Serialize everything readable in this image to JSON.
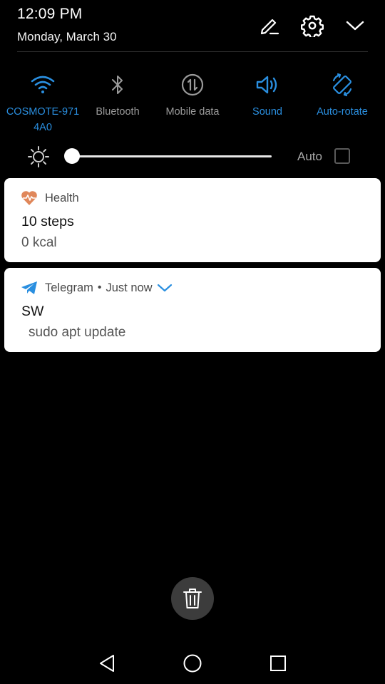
{
  "status": {
    "time": "12:09 PM",
    "date": "Monday, March 30"
  },
  "header_icons": {
    "edit": "edit-pencil-icon",
    "settings": "gear-icon",
    "collapse": "chevron-down-icon"
  },
  "quick_tiles": [
    {
      "label_line1": "COSMOTE-971",
      "label_line2": "4A0",
      "icon": "wifi-icon",
      "active": true
    },
    {
      "label_line1": "Bluetooth",
      "label_line2": "",
      "icon": "bluetooth-icon",
      "active": false
    },
    {
      "label_line1": "Mobile data",
      "label_line2": "",
      "icon": "mobile-data-icon",
      "active": false
    },
    {
      "label_line1": "Sound",
      "label_line2": "",
      "icon": "speaker-icon",
      "active": true
    },
    {
      "label_line1": "Auto-rotate",
      "label_line2": "",
      "icon": "auto-rotate-icon",
      "active": true
    }
  ],
  "brightness": {
    "auto_label": "Auto",
    "auto_checked": false,
    "level": 0.0
  },
  "notifications": [
    {
      "app": "Health",
      "icon": "heart-pulse-icon",
      "title": "10 steps",
      "body": "0 kcal"
    },
    {
      "app": "Telegram",
      "separator": "•",
      "time": "Just now",
      "icon": "telegram-plane-icon",
      "title": "SW",
      "body": "sudo apt update"
    }
  ],
  "colors": {
    "accent": "#2a8fe0",
    "health": "#e0875a",
    "telegram": "#2a8fe0",
    "inactive": "#9a9a9a"
  },
  "nav": {
    "back": "back-triangle-icon",
    "home": "home-circle-icon",
    "recents": "recents-square-icon"
  }
}
